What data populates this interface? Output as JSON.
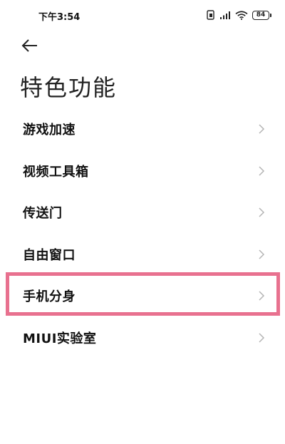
{
  "status_bar": {
    "time": "下午3:54",
    "battery_level": "84"
  },
  "header": {
    "back_icon": "back-arrow-icon",
    "title": "特色功能"
  },
  "menu": {
    "items": [
      {
        "label": "游戏加速",
        "icon": "chevron-right-icon"
      },
      {
        "label": "视频工具箱",
        "icon": "chevron-right-icon"
      },
      {
        "label": "传送门",
        "icon": "chevron-right-icon"
      },
      {
        "label": "自由窗口",
        "icon": "chevron-right-icon"
      },
      {
        "label": "手机分身",
        "icon": "chevron-right-icon",
        "highlighted": true
      },
      {
        "label": "MIUI实验室",
        "icon": "chevron-right-icon"
      }
    ]
  },
  "colors": {
    "highlight_border": "#e8718f",
    "chevron": "#b5b5b5",
    "text": "#111111"
  }
}
